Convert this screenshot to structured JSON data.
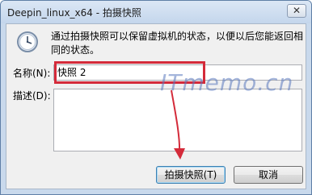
{
  "window": {
    "title": "Deepin_linux_x64 - 拍摄快照",
    "close_glyph": "✕"
  },
  "dialog": {
    "description": "通过拍摄快照可以保留虚拟机的状态，以便以后您能返回相同的状态。",
    "name_label": "名称(N):",
    "name_value": "快照 2",
    "desc_label": "描述(D):",
    "desc_value": "",
    "watermark": "ITmemo.cn",
    "icon": "clock-icon"
  },
  "buttons": {
    "snapshot": "拍摄快照(T)",
    "cancel": "取消"
  },
  "colors": {
    "highlight_red": "#d42b3a",
    "window_border": "#5f7fa6",
    "client_bg": "#f0f0f0"
  }
}
